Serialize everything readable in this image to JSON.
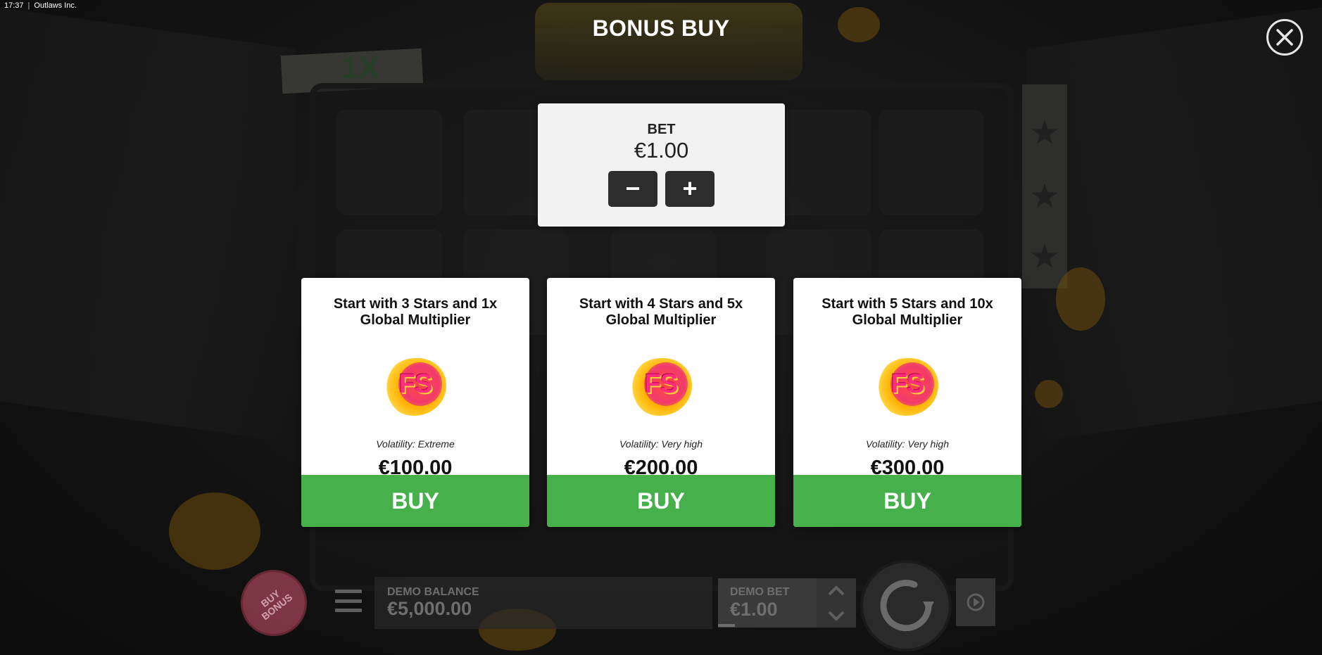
{
  "status": {
    "time": "17:37",
    "window_title": "Outlaws Inc."
  },
  "background": {
    "multiplier_tape": "1X"
  },
  "dialog": {
    "title": "BONUS BUY",
    "close_icon": "close-icon"
  },
  "bet": {
    "label": "BET",
    "value": "€1.00",
    "decrease_label": "−",
    "increase_label": "+"
  },
  "cards": [
    {
      "title": "Start with 3 Stars and 1x Global Multiplier",
      "badge": "FS",
      "volatility": "Volatility: Extreme",
      "price": "€100.00",
      "buy_label": "BUY"
    },
    {
      "title": "Start with 4 Stars and 5x Global Multiplier",
      "badge": "FS",
      "volatility": "Volatility: Very high",
      "price": "€200.00",
      "buy_label": "BUY"
    },
    {
      "title": "Start with 5 Stars and 10x Global Multiplier",
      "badge": "FS",
      "volatility": "Volatility: Very high",
      "price": "€300.00",
      "buy_label": "BUY"
    }
  ],
  "controls": {
    "buy_bonus_label": "BUY BONUS",
    "balance_label": "DEMO BALANCE",
    "balance_value": "€5,000.00",
    "demo_bet_label": "DEMO BET",
    "demo_bet_value": "€1.00"
  },
  "colors": {
    "buy_green": "#46b14b",
    "panel_bg": "#f2f2f2",
    "accent_splat": "#c98a18"
  }
}
